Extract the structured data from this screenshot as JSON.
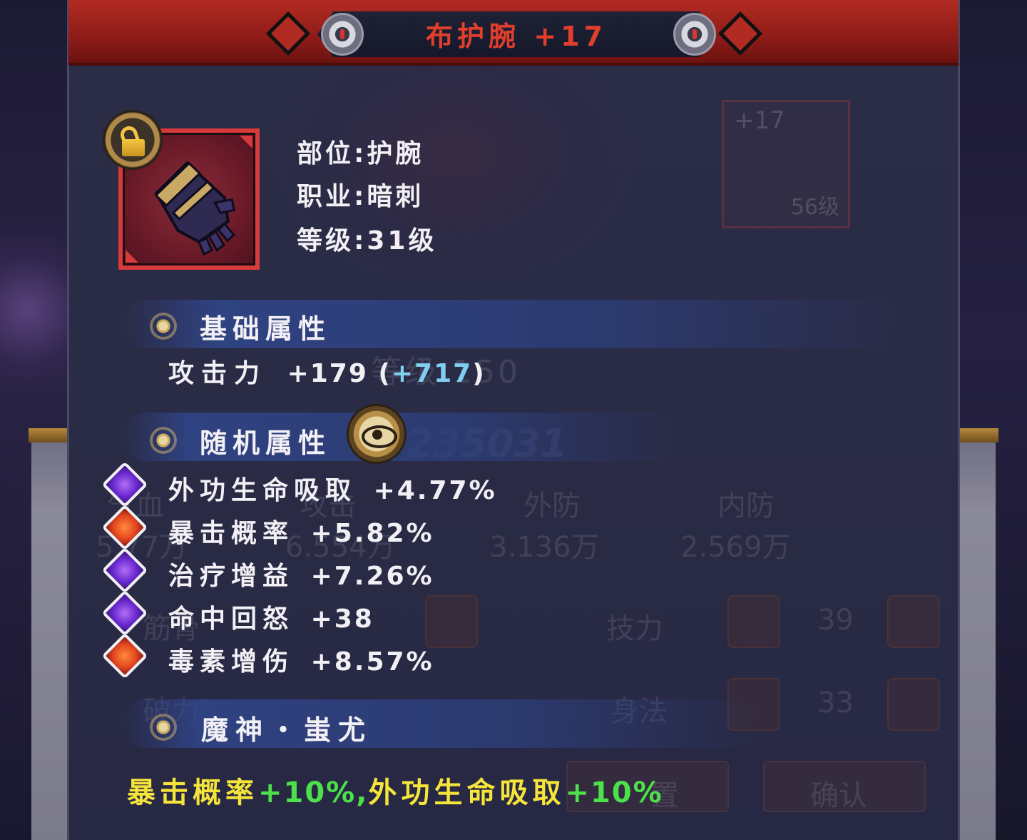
{
  "title": "布护腕 +17",
  "item": {
    "slot": "部位:护腕",
    "class": "职业:暗刺",
    "level": "等级:31级",
    "icon": "gauntlet-icon",
    "lock_state": "unlocked"
  },
  "base_section": {
    "title": "基础属性",
    "stat_name": "攻击力",
    "stat_value": "+179",
    "bonus_open": "(",
    "bonus_value": "+717",
    "bonus_close": ")"
  },
  "random_section": {
    "title": "随机属性",
    "stats": [
      {
        "name": "外功生命吸取",
        "value": "+4.77%",
        "gem": "purple"
      },
      {
        "name": "暴击概率",
        "value": "+5.82%",
        "gem": "red"
      },
      {
        "name": "治疗增益",
        "value": "+7.26%",
        "gem": "purple"
      },
      {
        "name": "命中回怒",
        "value": "+38",
        "gem": "purple"
      },
      {
        "name": "毒素增伤",
        "value": "+8.57%",
        "gem": "red"
      }
    ]
  },
  "set_section": {
    "title": "魔神・蚩尤",
    "bonus_a_name": "暴击概率",
    "bonus_a_value": "+10%,",
    "bonus_b_name": "外功生命吸取",
    "bonus_b_value": "+10%"
  },
  "background": {
    "ghost_card_top": "+17",
    "ghost_card_bottom": "56级",
    "ghost_level": "等级 150",
    "ghost_number": "235031",
    "ghost_stats": [
      "气血",
      "攻击",
      "外防",
      "内防",
      "5.77万",
      "6.554万",
      "3.136万",
      "2.569万",
      "筋骨",
      "破力",
      "技力",
      "身法",
      "39",
      "33",
      "确认",
      "置"
    ]
  },
  "colors": {
    "title_red": "#e23e2c",
    "bonus_cyan": "#7fd0f0",
    "set_yellow": "#f5e43a",
    "set_green": "#4de04a"
  }
}
